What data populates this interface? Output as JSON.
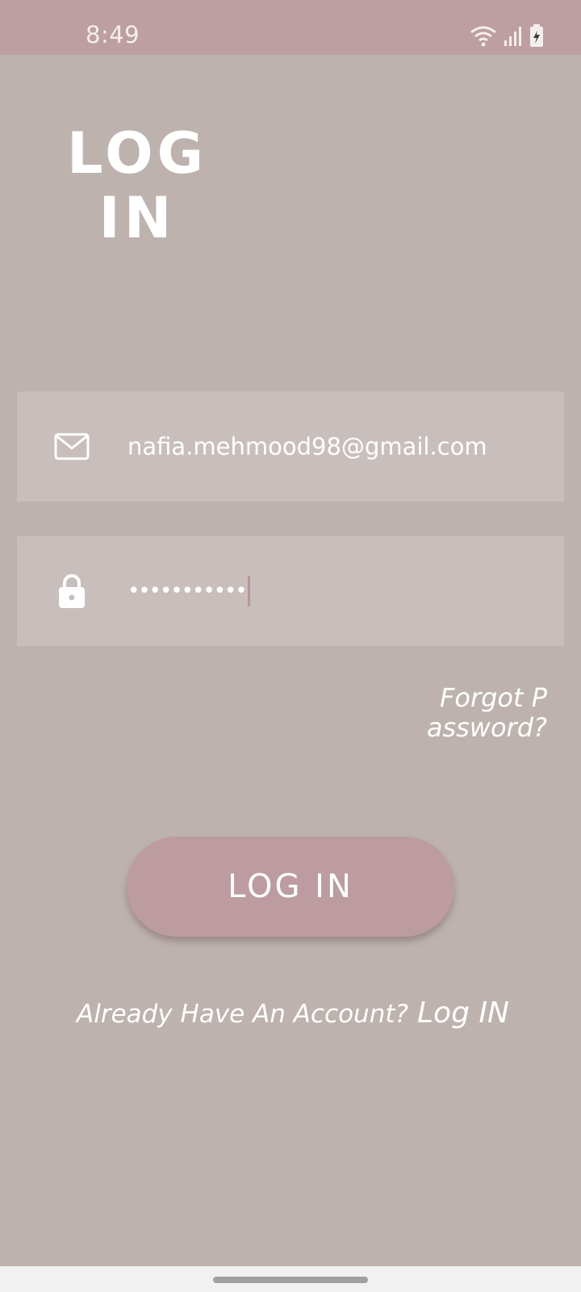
{
  "status_bar": {
    "time": "8:49",
    "icons": [
      "wifi-icon",
      "signal-icon",
      "battery-charging-icon"
    ]
  },
  "header": {
    "title": "LOG IN"
  },
  "form": {
    "email": {
      "icon": "mail-icon",
      "value": "nafia.mehmood98@gmail.com"
    },
    "password": {
      "icon": "lock-icon",
      "value": "•••••••••••"
    },
    "forgot_password_label": "Forgot Password?",
    "login_button_label": "LOG IN"
  },
  "footer": {
    "prompt": "Already Have An Account?",
    "link_label": "Log IN"
  },
  "colors": {
    "background": "#bdb2ae",
    "status_bar": "#bd9ea1",
    "field": "#c8bfbc",
    "button": "#bc9ca0",
    "text": "#ffffff"
  }
}
